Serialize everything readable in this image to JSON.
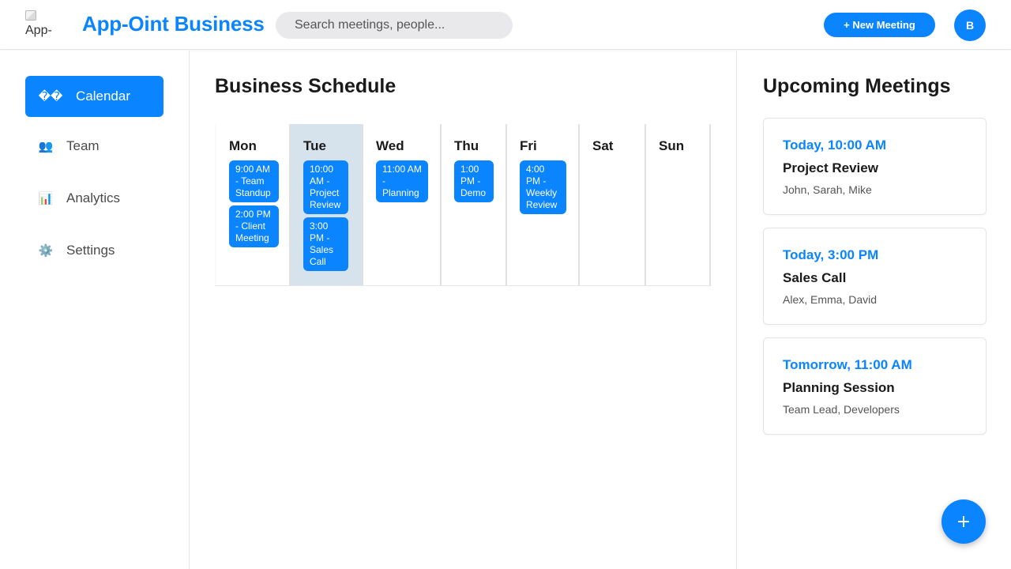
{
  "header": {
    "logo_alt": "App-",
    "brand": "App-Oint Business",
    "search_placeholder": "Search meetings, people...",
    "new_meeting_label": "+ New Meeting",
    "avatar_initial": "B"
  },
  "sidebar": {
    "items": [
      {
        "label": "Calendar",
        "icon_text": "��",
        "icon": "calendar-icon",
        "active": true
      },
      {
        "label": "Team",
        "icon_text": "👥",
        "icon": "team-icon",
        "active": false
      },
      {
        "label": "Analytics",
        "icon_text": "📊",
        "icon": "analytics-icon",
        "active": false
      },
      {
        "label": "Settings",
        "icon_text": "⚙️",
        "icon": "gear-icon",
        "active": false
      }
    ]
  },
  "main": {
    "title": "Business Schedule",
    "days": [
      {
        "name": "Mon",
        "events": [
          "9:00 AM - Team Standup",
          "2:00 PM - Client Meeting"
        ]
      },
      {
        "name": "Tue",
        "today": true,
        "events": [
          "10:00 AM - Project Review",
          "3:00 PM - Sales Call"
        ]
      },
      {
        "name": "Wed",
        "events": [
          "11:00 AM - Planning"
        ]
      },
      {
        "name": "Thu",
        "events": [
          "1:00 PM - Demo"
        ]
      },
      {
        "name": "Fri",
        "events": [
          "4:00 PM - Weekly Review"
        ]
      },
      {
        "name": "Sat",
        "events": []
      },
      {
        "name": "Sun",
        "events": []
      }
    ]
  },
  "upcoming": {
    "title": "Upcoming Meetings",
    "meetings": [
      {
        "time": "Today, 10:00 AM",
        "title": "Project Review",
        "people": "John, Sarah, Mike"
      },
      {
        "time": "Today, 3:00 PM",
        "title": "Sales Call",
        "people": "Alex, Emma, David"
      },
      {
        "time": "Tomorrow, 11:00 AM",
        "title": "Planning Session",
        "people": "Team Lead, Developers"
      }
    ]
  },
  "fab_label": "+",
  "colors": {
    "accent": "#0a84ff",
    "today_bg": "#d6e3ed",
    "search_bg": "#e9e9ec"
  }
}
